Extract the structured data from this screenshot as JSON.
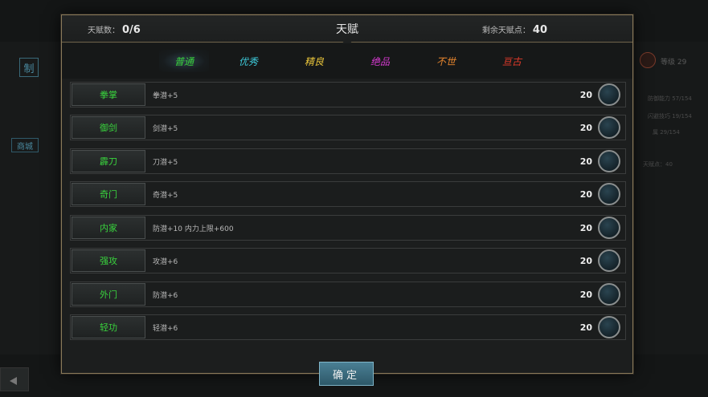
{
  "header": {
    "talent_count_label": "天赋数：",
    "talent_count_value": "0/6",
    "title": "天赋",
    "remaining_label": "剩余天赋点：",
    "remaining_value": "40"
  },
  "tabs": [
    {
      "label": "普通",
      "color": "#39d33d",
      "active": true
    },
    {
      "label": "优秀",
      "color": "#3dc8d8",
      "active": false
    },
    {
      "label": "精良",
      "color": "#e6c23a",
      "active": false
    },
    {
      "label": "绝品",
      "color": "#d63ad0",
      "active": false
    },
    {
      "label": "不世",
      "color": "#e8862e",
      "active": false
    },
    {
      "label": "亘古",
      "color": "#e23a2a",
      "active": false
    }
  ],
  "talents": [
    {
      "name": "拳掌",
      "desc": "拳潜+5",
      "cost": "20"
    },
    {
      "name": "御剑",
      "desc": "剑潜+5",
      "cost": "20"
    },
    {
      "name": "霹刀",
      "desc": "刀潜+5",
      "cost": "20"
    },
    {
      "name": "奇门",
      "desc": "奇潜+5",
      "cost": "20"
    },
    {
      "name": "内家",
      "desc": "防潜+10 内力上限+600",
      "cost": "20"
    },
    {
      "name": "强攻",
      "desc": "攻潜+6",
      "cost": "20"
    },
    {
      "name": "外门",
      "desc": "防潜+6",
      "cost": "20"
    },
    {
      "name": "轻功",
      "desc": "轻潜+6",
      "cost": "20"
    }
  ],
  "confirm_label": "确定",
  "background": {
    "badge": "制",
    "shop": "商城",
    "right_level": "等级 29",
    "right_line1": "防御能力 57/154",
    "right_line2": "闪避技巧 19/154",
    "right_line3": "属 29/154",
    "right_points": "天赋点：40"
  }
}
